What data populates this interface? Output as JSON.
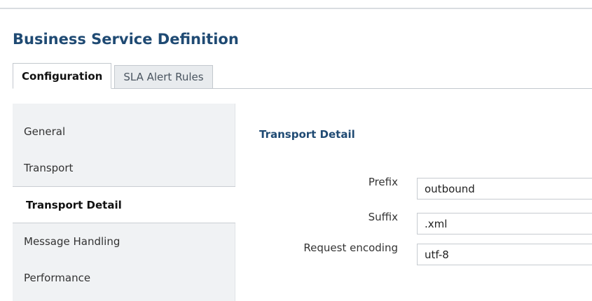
{
  "page": {
    "title": "Business Service Definition"
  },
  "tabs": [
    {
      "label": "Configuration",
      "active": true
    },
    {
      "label": "SLA Alert Rules",
      "active": false
    }
  ],
  "sidebar": {
    "items": [
      {
        "label": "General",
        "selected": false
      },
      {
        "label": "Transport",
        "selected": false
      },
      {
        "label": "Transport Detail",
        "selected": true
      },
      {
        "label": "Message Handling",
        "selected": false
      },
      {
        "label": "Performance",
        "selected": false
      }
    ]
  },
  "main": {
    "section_title": "Transport Detail",
    "fields": {
      "prefix": {
        "label": "Prefix",
        "value": "outbound"
      },
      "suffix": {
        "label": "Suffix",
        "value": ".xml"
      },
      "request_encoding": {
        "label": "Request encoding",
        "value": "utf-8"
      }
    }
  },
  "colors": {
    "heading": "#1f4a73",
    "sidebar_bg": "#f0f2f4",
    "inactive_tab_bg": "#e8ebee",
    "border": "#c3c8ce"
  }
}
